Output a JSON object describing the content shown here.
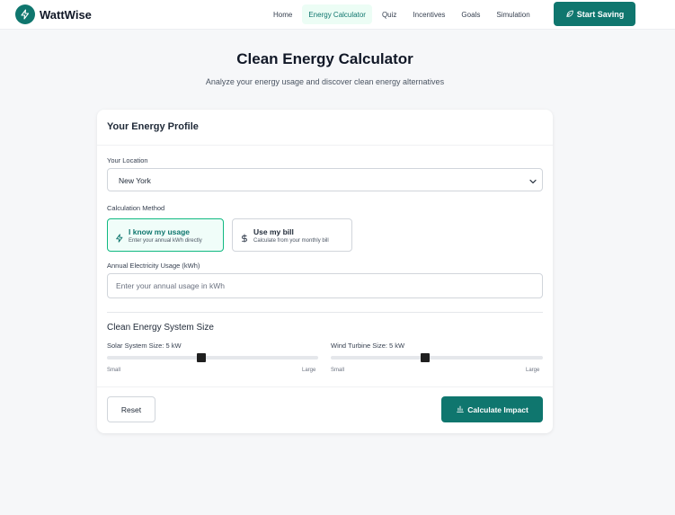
{
  "nav": {
    "brand": "WattWise",
    "links": [
      {
        "label": "Home",
        "active": false
      },
      {
        "label": "Energy Calculator",
        "active": true
      },
      {
        "label": "Quiz",
        "active": false
      },
      {
        "label": "Incentives",
        "active": false
      },
      {
        "label": "Goals",
        "active": false
      },
      {
        "label": "Simulation",
        "active": false
      }
    ],
    "cta_label": "Start Saving",
    "cta_icon": "leaf-icon"
  },
  "header": {
    "title": "Clean Energy Calculator",
    "subtitle": "Analyze your energy usage and discover clean energy alternatives"
  },
  "profile": {
    "title": "Your Energy Profile",
    "location_label": "Your Location",
    "location_value": "New York",
    "method_label": "Calculation Method",
    "methods": [
      {
        "title": "I know my usage",
        "desc": "Enter your annual kWh directly",
        "icon": "lightning-icon",
        "selected": true
      },
      {
        "title": "Use my bill",
        "desc": "Calculate from your monthly bill",
        "icon": "dollar-icon",
        "selected": false
      }
    ],
    "usage_label": "Annual Electricity Usage (kWh)",
    "usage_placeholder": "Enter your annual usage in kWh",
    "usage_value": ""
  },
  "system": {
    "title": "Clean Energy System Size",
    "solar_label": "Solar System Size: 5 kW",
    "solar_value": 5,
    "solar_min_label": "Small",
    "solar_max_label": "Large",
    "wind_label": "Wind Turbine Size: 5 kW",
    "wind_value": 5,
    "wind_min_label": "Small",
    "wind_max_label": "Large"
  },
  "actions": {
    "reset_label": "Reset",
    "calculate_label": "Calculate Impact",
    "calculate_icon": "bar-chart-icon"
  },
  "colors": {
    "primary": "#0f766e",
    "selected_border": "#10b981",
    "background": "#f6f7f9"
  }
}
